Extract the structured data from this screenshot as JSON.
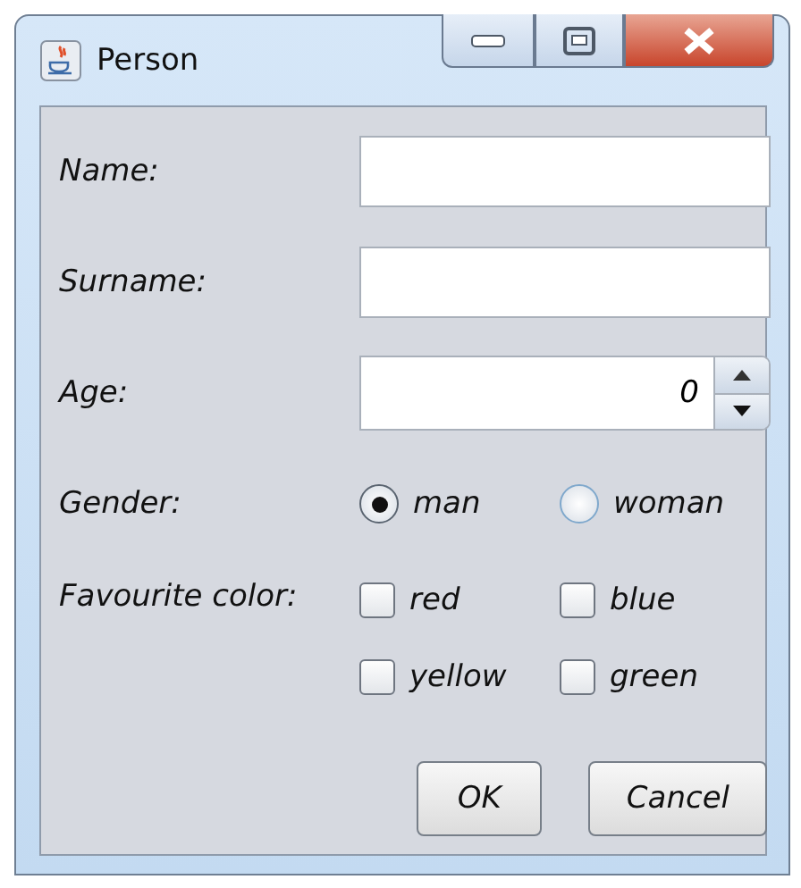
{
  "window": {
    "title": "Person"
  },
  "fields": [
    {
      "kind": "text",
      "label": "Name:"
    },
    {
      "kind": "text",
      "label": "Surname:"
    },
    {
      "kind": "spinner",
      "label": "Age:",
      "value": "0"
    }
  ],
  "gender": {
    "label": "Gender:",
    "options": [
      {
        "label": "man",
        "selected": true
      },
      {
        "label": "woman",
        "selected": false
      }
    ]
  },
  "colors": {
    "label": "Favourite color:",
    "options": [
      {
        "label": "red",
        "checked": false
      },
      {
        "label": "blue",
        "checked": false
      },
      {
        "label": "yellow",
        "checked": false
      },
      {
        "label": "green",
        "checked": false
      }
    ]
  },
  "buttons": [
    "OK",
    "Cancel"
  ]
}
